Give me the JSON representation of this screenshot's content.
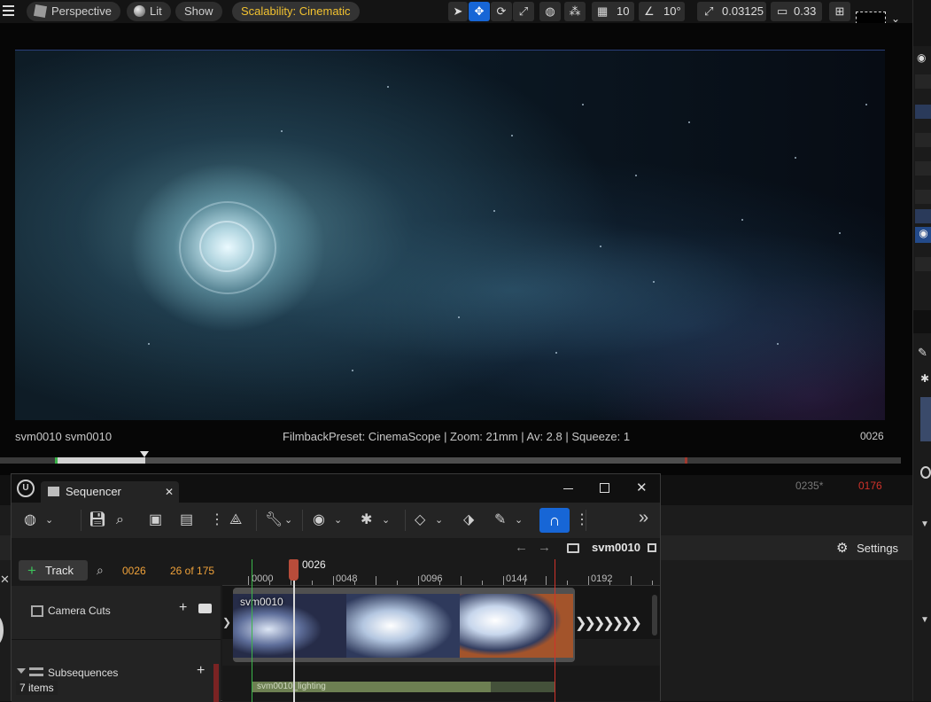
{
  "viewport_toolbar": {
    "perspective_label": "Perspective",
    "lit_label": "Lit",
    "show_label": "Show",
    "scalability_label": "Scalability: Cinematic",
    "grid_snap_value": "10",
    "rotation_snap_value": "10°",
    "scale_snap_value": "0.03125",
    "camera_speed_value": "0.33"
  },
  "viewport": {
    "shot_label": "svm0010 svm0010",
    "filmback_info": "FilmbackPreset: CinemaScope | Zoom: 21mm | Av: 2.8 | Squeeze: 1",
    "current_frame": "0026",
    "end_frame_label": "0235*",
    "end_frame_red": "0176"
  },
  "sequencer": {
    "tab_label": "Sequencer",
    "breadcrumb_sequence": "svm0010",
    "settings_label": "Settings",
    "track_button_label": "Track",
    "current_frame": "0026",
    "frame_count": "26 of 175",
    "playhead_label": "0026",
    "ruler_labels": [
      "0000",
      "0048",
      "0096",
      "0144",
      "0192"
    ],
    "tracks": [
      {
        "label": "Camera Cuts"
      },
      {
        "label": "Subsequences"
      }
    ],
    "section_label": "svm0010",
    "subsequence_label": "svm0010_lighting",
    "status_items": "7 items"
  },
  "colors": {
    "accent_blue": "#1766d6",
    "scalability_yellow": "#f2c230",
    "frame_orange": "#f0a23a",
    "end_red": "#d0322a"
  }
}
